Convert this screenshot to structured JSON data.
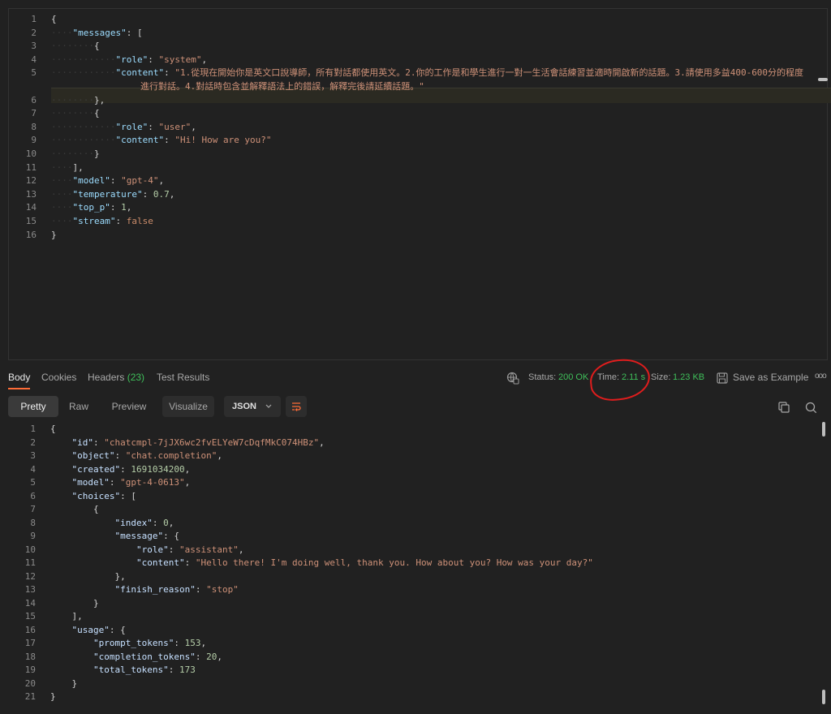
{
  "request": {
    "lines": [
      {
        "n": "1",
        "tokens": [
          {
            "t": "{",
            "c": "p"
          }
        ]
      },
      {
        "n": "2",
        "tokens": [
          {
            "t": "····",
            "c": "dots"
          },
          {
            "t": "\"messages\"",
            "c": "k"
          },
          {
            "t": ": [",
            "c": "p"
          }
        ]
      },
      {
        "n": "3",
        "tokens": [
          {
            "t": "········",
            "c": "dots"
          },
          {
            "t": "{",
            "c": "p"
          }
        ]
      },
      {
        "n": "4",
        "tokens": [
          {
            "t": "············",
            "c": "dots"
          },
          {
            "t": "\"role\"",
            "c": "k"
          },
          {
            "t": ": ",
            "c": "p"
          },
          {
            "t": "\"system\"",
            "c": "s"
          },
          {
            "t": ",",
            "c": "p"
          }
        ]
      },
      {
        "n": "5",
        "tokens": [
          {
            "t": "············",
            "c": "dots"
          },
          {
            "t": "\"content\"",
            "c": "k"
          },
          {
            "t": ": ",
            "c": "p"
          },
          {
            "t": "\"1.從現在開始你是英文口說導師，所有對話都使用英文。2.你的工作是和學生進行一對一生活會話練習並適時開啟新的話題。3.請使用多益400-600分的程度",
            "c": "s"
          }
        ]
      },
      {
        "n": "",
        "tokens": [
          {
            "t": "進行對話。4.對話時包含並解釋語法上的錯誤，解釋完後請延續話題。\"",
            "c": "s"
          }
        ],
        "indent": "110"
      },
      {
        "n": "6",
        "tokens": [
          {
            "t": "········",
            "c": "dots"
          },
          {
            "t": "},",
            "c": "p"
          }
        ]
      },
      {
        "n": "7",
        "tokens": [
          {
            "t": "········",
            "c": "dots"
          },
          {
            "t": "{",
            "c": "p"
          }
        ]
      },
      {
        "n": "8",
        "tokens": [
          {
            "t": "············",
            "c": "dots"
          },
          {
            "t": "\"role\"",
            "c": "k"
          },
          {
            "t": ": ",
            "c": "p"
          },
          {
            "t": "\"user\"",
            "c": "s"
          },
          {
            "t": ",",
            "c": "p"
          }
        ]
      },
      {
        "n": "9",
        "tokens": [
          {
            "t": "············",
            "c": "dots"
          },
          {
            "t": "\"content\"",
            "c": "k"
          },
          {
            "t": ": ",
            "c": "p"
          },
          {
            "t": "\"Hi! How are you?\"",
            "c": "s"
          }
        ]
      },
      {
        "n": "10",
        "tokens": [
          {
            "t": "········",
            "c": "dots"
          },
          {
            "t": "}",
            "c": "p"
          }
        ]
      },
      {
        "n": "11",
        "tokens": [
          {
            "t": "····",
            "c": "dots"
          },
          {
            "t": "],",
            "c": "p"
          }
        ]
      },
      {
        "n": "12",
        "tokens": [
          {
            "t": "····",
            "c": "dots"
          },
          {
            "t": "\"model\"",
            "c": "k"
          },
          {
            "t": ": ",
            "c": "p"
          },
          {
            "t": "\"gpt-4\"",
            "c": "s"
          },
          {
            "t": ",",
            "c": "p"
          }
        ]
      },
      {
        "n": "13",
        "tokens": [
          {
            "t": "····",
            "c": "dots"
          },
          {
            "t": "\"temperature\"",
            "c": "k"
          },
          {
            "t": ": ",
            "c": "p"
          },
          {
            "t": "0.7",
            "c": "n"
          },
          {
            "t": ",",
            "c": "p"
          }
        ]
      },
      {
        "n": "14",
        "tokens": [
          {
            "t": "····",
            "c": "dots"
          },
          {
            "t": "\"top_p\"",
            "c": "k"
          },
          {
            "t": ": ",
            "c": "p"
          },
          {
            "t": "1",
            "c": "n"
          },
          {
            "t": ",",
            "c": "p"
          }
        ]
      },
      {
        "n": "15",
        "tokens": [
          {
            "t": "····",
            "c": "dots"
          },
          {
            "t": "\"stream\"",
            "c": "k"
          },
          {
            "t": ": ",
            "c": "p"
          },
          {
            "t": "false",
            "c": "b"
          }
        ]
      },
      {
        "n": "16",
        "tokens": [
          {
            "t": "}",
            "c": "p"
          }
        ]
      }
    ]
  },
  "response_tabs": {
    "body": "Body",
    "cookies": "Cookies",
    "headers": "Headers",
    "headers_count": "(23)",
    "test_results": "Test Results"
  },
  "response_meta": {
    "status_label": "Status:",
    "status_value": "200 OK",
    "time_label": "Time:",
    "time_value": "2.11 s",
    "size_label": "Size:",
    "size_value": "1.23 KB",
    "save_example": "Save as Example",
    "more": "ooo"
  },
  "view_tabs": {
    "pretty": "Pretty",
    "raw": "Raw",
    "preview": "Preview",
    "visualize": "Visualize",
    "format": "JSON"
  },
  "response": {
    "lines": [
      {
        "n": "1",
        "tokens": [
          {
            "t": "{",
            "c": "p"
          }
        ]
      },
      {
        "n": "2",
        "tokens": [
          {
            "t": "    ",
            "c": "p"
          },
          {
            "t": "\"id\"",
            "c": "k2"
          },
          {
            "t": ": ",
            "c": "p"
          },
          {
            "t": "\"chatcmpl-7jJX6wc2fvELYeW7cDqfMkC074HBz\"",
            "c": "s"
          },
          {
            "t": ",",
            "c": "p"
          }
        ]
      },
      {
        "n": "3",
        "tokens": [
          {
            "t": "    ",
            "c": "p"
          },
          {
            "t": "\"object\"",
            "c": "k2"
          },
          {
            "t": ": ",
            "c": "p"
          },
          {
            "t": "\"chat.completion\"",
            "c": "s"
          },
          {
            "t": ",",
            "c": "p"
          }
        ]
      },
      {
        "n": "4",
        "tokens": [
          {
            "t": "    ",
            "c": "p"
          },
          {
            "t": "\"created\"",
            "c": "k2"
          },
          {
            "t": ": ",
            "c": "p"
          },
          {
            "t": "1691034200",
            "c": "n"
          },
          {
            "t": ",",
            "c": "p"
          }
        ]
      },
      {
        "n": "5",
        "tokens": [
          {
            "t": "    ",
            "c": "p"
          },
          {
            "t": "\"model\"",
            "c": "k2"
          },
          {
            "t": ": ",
            "c": "p"
          },
          {
            "t": "\"gpt-4-0613\"",
            "c": "s"
          },
          {
            "t": ",",
            "c": "p"
          }
        ]
      },
      {
        "n": "6",
        "tokens": [
          {
            "t": "    ",
            "c": "p"
          },
          {
            "t": "\"choices\"",
            "c": "k2"
          },
          {
            "t": ": [",
            "c": "p"
          }
        ]
      },
      {
        "n": "7",
        "tokens": [
          {
            "t": "        {",
            "c": "p"
          }
        ]
      },
      {
        "n": "8",
        "tokens": [
          {
            "t": "            ",
            "c": "p"
          },
          {
            "t": "\"index\"",
            "c": "k2"
          },
          {
            "t": ": ",
            "c": "p"
          },
          {
            "t": "0",
            "c": "n"
          },
          {
            "t": ",",
            "c": "p"
          }
        ]
      },
      {
        "n": "9",
        "tokens": [
          {
            "t": "            ",
            "c": "p"
          },
          {
            "t": "\"message\"",
            "c": "k2"
          },
          {
            "t": ": {",
            "c": "p"
          }
        ]
      },
      {
        "n": "10",
        "tokens": [
          {
            "t": "                ",
            "c": "p"
          },
          {
            "t": "\"role\"",
            "c": "k2"
          },
          {
            "t": ": ",
            "c": "p"
          },
          {
            "t": "\"assistant\"",
            "c": "s"
          },
          {
            "t": ",",
            "c": "p"
          }
        ]
      },
      {
        "n": "11",
        "tokens": [
          {
            "t": "                ",
            "c": "p"
          },
          {
            "t": "\"content\"",
            "c": "k2"
          },
          {
            "t": ": ",
            "c": "p"
          },
          {
            "t": "\"Hello there! I'm doing well, thank you. How about you? How was your day?\"",
            "c": "s"
          }
        ]
      },
      {
        "n": "12",
        "tokens": [
          {
            "t": "            },",
            "c": "p"
          }
        ]
      },
      {
        "n": "13",
        "tokens": [
          {
            "t": "            ",
            "c": "p"
          },
          {
            "t": "\"finish_reason\"",
            "c": "k2"
          },
          {
            "t": ": ",
            "c": "p"
          },
          {
            "t": "\"stop\"",
            "c": "s"
          }
        ]
      },
      {
        "n": "14",
        "tokens": [
          {
            "t": "        }",
            "c": "p"
          }
        ]
      },
      {
        "n": "15",
        "tokens": [
          {
            "t": "    ],",
            "c": "p"
          }
        ]
      },
      {
        "n": "16",
        "tokens": [
          {
            "t": "    ",
            "c": "p"
          },
          {
            "t": "\"usage\"",
            "c": "k2"
          },
          {
            "t": ": {",
            "c": "p"
          }
        ]
      },
      {
        "n": "17",
        "tokens": [
          {
            "t": "        ",
            "c": "p"
          },
          {
            "t": "\"prompt_tokens\"",
            "c": "k2"
          },
          {
            "t": ": ",
            "c": "p"
          },
          {
            "t": "153",
            "c": "n"
          },
          {
            "t": ",",
            "c": "p"
          }
        ]
      },
      {
        "n": "18",
        "tokens": [
          {
            "t": "        ",
            "c": "p"
          },
          {
            "t": "\"completion_tokens\"",
            "c": "k2"
          },
          {
            "t": ": ",
            "c": "p"
          },
          {
            "t": "20",
            "c": "n"
          },
          {
            "t": ",",
            "c": "p"
          }
        ]
      },
      {
        "n": "19",
        "tokens": [
          {
            "t": "        ",
            "c": "p"
          },
          {
            "t": "\"total_tokens\"",
            "c": "k2"
          },
          {
            "t": ": ",
            "c": "p"
          },
          {
            "t": "173",
            "c": "n"
          }
        ]
      },
      {
        "n": "20",
        "tokens": [
          {
            "t": "    }",
            "c": "p"
          }
        ]
      },
      {
        "n": "21",
        "tokens": [
          {
            "t": "}",
            "c": "p"
          }
        ]
      }
    ]
  },
  "colors": {
    "accent": "#ff6c37",
    "status_ok": "#3fbf5a",
    "annotation": "#e01d1d"
  }
}
